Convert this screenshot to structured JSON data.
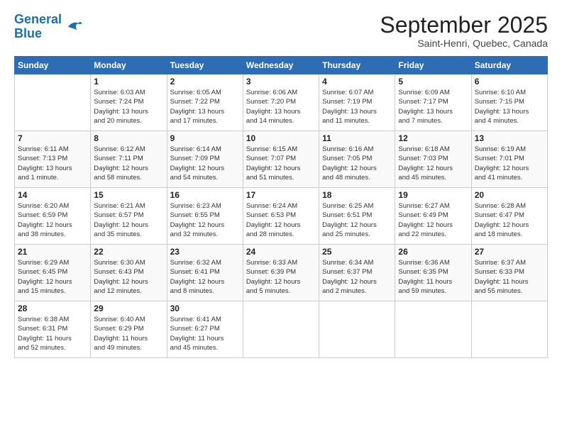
{
  "logo": {
    "line1": "General",
    "line2": "Blue"
  },
  "title": "September 2025",
  "location": "Saint-Henri, Quebec, Canada",
  "days_of_week": [
    "Sunday",
    "Monday",
    "Tuesday",
    "Wednesday",
    "Thursday",
    "Friday",
    "Saturday"
  ],
  "weeks": [
    [
      {
        "day": "",
        "info": ""
      },
      {
        "day": "1",
        "info": "Sunrise: 6:03 AM\nSunset: 7:24 PM\nDaylight: 13 hours\nand 20 minutes."
      },
      {
        "day": "2",
        "info": "Sunrise: 6:05 AM\nSunset: 7:22 PM\nDaylight: 13 hours\nand 17 minutes."
      },
      {
        "day": "3",
        "info": "Sunrise: 6:06 AM\nSunset: 7:20 PM\nDaylight: 13 hours\nand 14 minutes."
      },
      {
        "day": "4",
        "info": "Sunrise: 6:07 AM\nSunset: 7:19 PM\nDaylight: 13 hours\nand 11 minutes."
      },
      {
        "day": "5",
        "info": "Sunrise: 6:09 AM\nSunset: 7:17 PM\nDaylight: 13 hours\nand 7 minutes."
      },
      {
        "day": "6",
        "info": "Sunrise: 6:10 AM\nSunset: 7:15 PM\nDaylight: 13 hours\nand 4 minutes."
      }
    ],
    [
      {
        "day": "7",
        "info": "Sunrise: 6:11 AM\nSunset: 7:13 PM\nDaylight: 13 hours\nand 1 minute."
      },
      {
        "day": "8",
        "info": "Sunrise: 6:12 AM\nSunset: 7:11 PM\nDaylight: 12 hours\nand 58 minutes."
      },
      {
        "day": "9",
        "info": "Sunrise: 6:14 AM\nSunset: 7:09 PM\nDaylight: 12 hours\nand 54 minutes."
      },
      {
        "day": "10",
        "info": "Sunrise: 6:15 AM\nSunset: 7:07 PM\nDaylight: 12 hours\nand 51 minutes."
      },
      {
        "day": "11",
        "info": "Sunrise: 6:16 AM\nSunset: 7:05 PM\nDaylight: 12 hours\nand 48 minutes."
      },
      {
        "day": "12",
        "info": "Sunrise: 6:18 AM\nSunset: 7:03 PM\nDaylight: 12 hours\nand 45 minutes."
      },
      {
        "day": "13",
        "info": "Sunrise: 6:19 AM\nSunset: 7:01 PM\nDaylight: 12 hours\nand 41 minutes."
      }
    ],
    [
      {
        "day": "14",
        "info": "Sunrise: 6:20 AM\nSunset: 6:59 PM\nDaylight: 12 hours\nand 38 minutes."
      },
      {
        "day": "15",
        "info": "Sunrise: 6:21 AM\nSunset: 6:57 PM\nDaylight: 12 hours\nand 35 minutes."
      },
      {
        "day": "16",
        "info": "Sunrise: 6:23 AM\nSunset: 6:55 PM\nDaylight: 12 hours\nand 32 minutes."
      },
      {
        "day": "17",
        "info": "Sunrise: 6:24 AM\nSunset: 6:53 PM\nDaylight: 12 hours\nand 28 minutes."
      },
      {
        "day": "18",
        "info": "Sunrise: 6:25 AM\nSunset: 6:51 PM\nDaylight: 12 hours\nand 25 minutes."
      },
      {
        "day": "19",
        "info": "Sunrise: 6:27 AM\nSunset: 6:49 PM\nDaylight: 12 hours\nand 22 minutes."
      },
      {
        "day": "20",
        "info": "Sunrise: 6:28 AM\nSunset: 6:47 PM\nDaylight: 12 hours\nand 18 minutes."
      }
    ],
    [
      {
        "day": "21",
        "info": "Sunrise: 6:29 AM\nSunset: 6:45 PM\nDaylight: 12 hours\nand 15 minutes."
      },
      {
        "day": "22",
        "info": "Sunrise: 6:30 AM\nSunset: 6:43 PM\nDaylight: 12 hours\nand 12 minutes."
      },
      {
        "day": "23",
        "info": "Sunrise: 6:32 AM\nSunset: 6:41 PM\nDaylight: 12 hours\nand 8 minutes."
      },
      {
        "day": "24",
        "info": "Sunrise: 6:33 AM\nSunset: 6:39 PM\nDaylight: 12 hours\nand 5 minutes."
      },
      {
        "day": "25",
        "info": "Sunrise: 6:34 AM\nSunset: 6:37 PM\nDaylight: 12 hours\nand 2 minutes."
      },
      {
        "day": "26",
        "info": "Sunrise: 6:36 AM\nSunset: 6:35 PM\nDaylight: 11 hours\nand 59 minutes."
      },
      {
        "day": "27",
        "info": "Sunrise: 6:37 AM\nSunset: 6:33 PM\nDaylight: 11 hours\nand 55 minutes."
      }
    ],
    [
      {
        "day": "28",
        "info": "Sunrise: 6:38 AM\nSunset: 6:31 PM\nDaylight: 11 hours\nand 52 minutes."
      },
      {
        "day": "29",
        "info": "Sunrise: 6:40 AM\nSunset: 6:29 PM\nDaylight: 11 hours\nand 49 minutes."
      },
      {
        "day": "30",
        "info": "Sunrise: 6:41 AM\nSunset: 6:27 PM\nDaylight: 11 hours\nand 45 minutes."
      },
      {
        "day": "",
        "info": ""
      },
      {
        "day": "",
        "info": ""
      },
      {
        "day": "",
        "info": ""
      },
      {
        "day": "",
        "info": ""
      }
    ]
  ]
}
